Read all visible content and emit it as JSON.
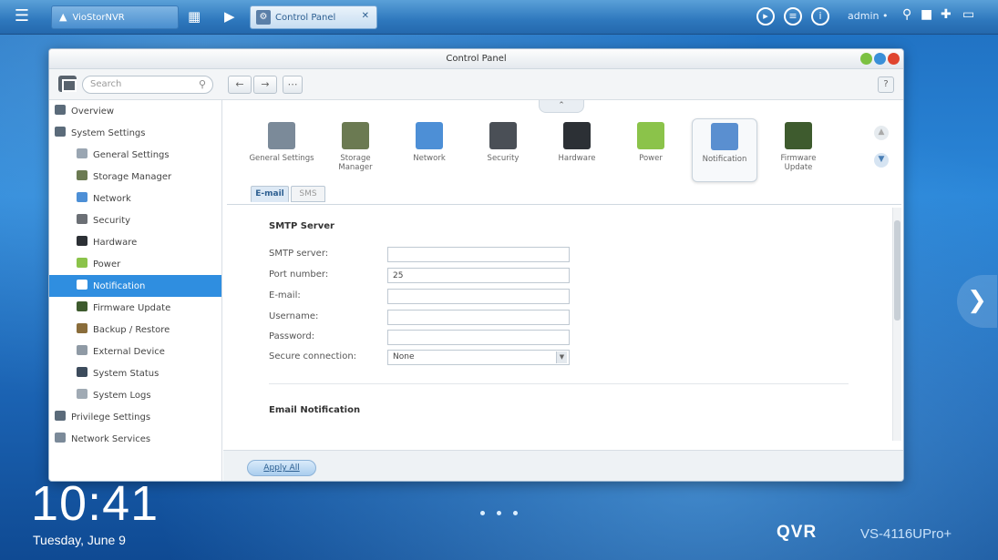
{
  "taskbar": {
    "home_tab_label": "VioStorNVR",
    "window_tab_label": "Control Panel",
    "user_label": "admin •"
  },
  "window": {
    "title": "Control Panel",
    "search_placeholder": "Search",
    "help_label": "?"
  },
  "sidebar": {
    "items": [
      {
        "label": "Overview",
        "level": 1,
        "icon": "overview-icon"
      },
      {
        "label": "System Settings",
        "level": 1,
        "icon": "gear-icon"
      },
      {
        "label": "General Settings",
        "level": 2,
        "icon": "general-settings-icon"
      },
      {
        "label": "Storage Manager",
        "level": 2,
        "icon": "storage-icon"
      },
      {
        "label": "Network",
        "level": 2,
        "icon": "network-icon"
      },
      {
        "label": "Security",
        "level": 2,
        "icon": "lock-icon"
      },
      {
        "label": "Hardware",
        "level": 2,
        "icon": "hardware-icon"
      },
      {
        "label": "Power",
        "level": 2,
        "icon": "power-icon"
      },
      {
        "label": "Notification",
        "level": 2,
        "icon": "notification-icon",
        "active": true
      },
      {
        "label": "Firmware Update",
        "level": 2,
        "icon": "firmware-icon"
      },
      {
        "label": "Backup / Restore",
        "level": 2,
        "icon": "backup-icon"
      },
      {
        "label": "External Device",
        "level": 2,
        "icon": "external-device-icon"
      },
      {
        "label": "System Status",
        "level": 2,
        "icon": "system-status-icon"
      },
      {
        "label": "System Logs",
        "level": 2,
        "icon": "system-logs-icon"
      },
      {
        "label": "Privilege Settings",
        "level": 1,
        "icon": "user-icon"
      },
      {
        "label": "Network Services",
        "level": 1,
        "icon": "network-services-icon"
      }
    ]
  },
  "apps": [
    {
      "label": "General Settings",
      "color": "#7b8a99"
    },
    {
      "label": "Storage Manager",
      "color": "#6b7a52"
    },
    {
      "label": "Network",
      "color": "#4d8fd6"
    },
    {
      "label": "Security",
      "color": "#4a4f56"
    },
    {
      "label": "Hardware",
      "color": "#2c3035"
    },
    {
      "label": "Power",
      "color": "#8bc34a"
    },
    {
      "label": "Notification",
      "color": "#5a8fd0",
      "selected": true
    },
    {
      "label": "Firmware Update",
      "color": "#3e5b2e"
    }
  ],
  "subtabs": {
    "email": "E-mail",
    "sms": "SMS"
  },
  "smtp": {
    "section_title": "SMTP Server",
    "fields": [
      {
        "label": "SMTP server:",
        "value": ""
      },
      {
        "label": "Port number:",
        "value": "25"
      },
      {
        "label": "E-mail:",
        "value": ""
      },
      {
        "label": "Username:",
        "value": ""
      },
      {
        "label": "Password:",
        "value": ""
      }
    ],
    "secure_label": "Secure connection:",
    "secure_value": "None"
  },
  "email_notification": {
    "section_title": "Email Notification"
  },
  "footer": {
    "apply_label": "Apply All"
  },
  "desktop": {
    "time": "10:41",
    "date": "Tuesday, June 9",
    "brand": "QVR",
    "model": "VS-4116UPro+"
  },
  "colors": {
    "accent": "#2f8ee0",
    "desktop": "#2a86d8"
  }
}
